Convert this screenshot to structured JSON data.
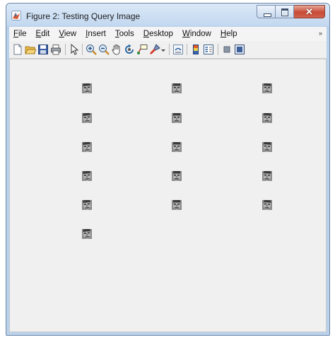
{
  "window": {
    "title": "Figure 2: Testing Query Image"
  },
  "menu": [
    {
      "label": "File",
      "key": "F",
      "rest": "ile"
    },
    {
      "label": "Edit",
      "key": "E",
      "rest": "dit"
    },
    {
      "label": "View",
      "key": "V",
      "rest": "iew"
    },
    {
      "label": "Insert",
      "key": "I",
      "rest": "nsert"
    },
    {
      "label": "Tools",
      "key": "T",
      "rest": "ools"
    },
    {
      "label": "Desktop",
      "key": "D",
      "rest": "esktop"
    },
    {
      "label": "Window",
      "key": "W",
      "rest": "indow"
    },
    {
      "label": "Help",
      "key": "H",
      "rest": "elp"
    }
  ],
  "menu_overflow": "»",
  "toolbar": {
    "icons": [
      "new-figure-icon",
      "open-file-icon",
      "save-icon",
      "print-icon",
      "edit-plot-arrow-icon",
      "zoom-in-icon",
      "zoom-out-icon",
      "pan-hand-icon",
      "rotate-3d-icon",
      "data-cursor-icon",
      "brush-icon",
      "brush-dropdown-icon",
      "link-plot-icon",
      "colorbar-icon",
      "legend-icon",
      "hide-plot-tools-icon",
      "show-plot-tools-icon"
    ]
  },
  "images": {
    "count": 16,
    "columns": 3,
    "thumbnail": "face-thumbnail"
  },
  "colors": {
    "chrome": "#b9d1ea",
    "canvas": "#f0f0f0",
    "close": "#c74a35"
  }
}
